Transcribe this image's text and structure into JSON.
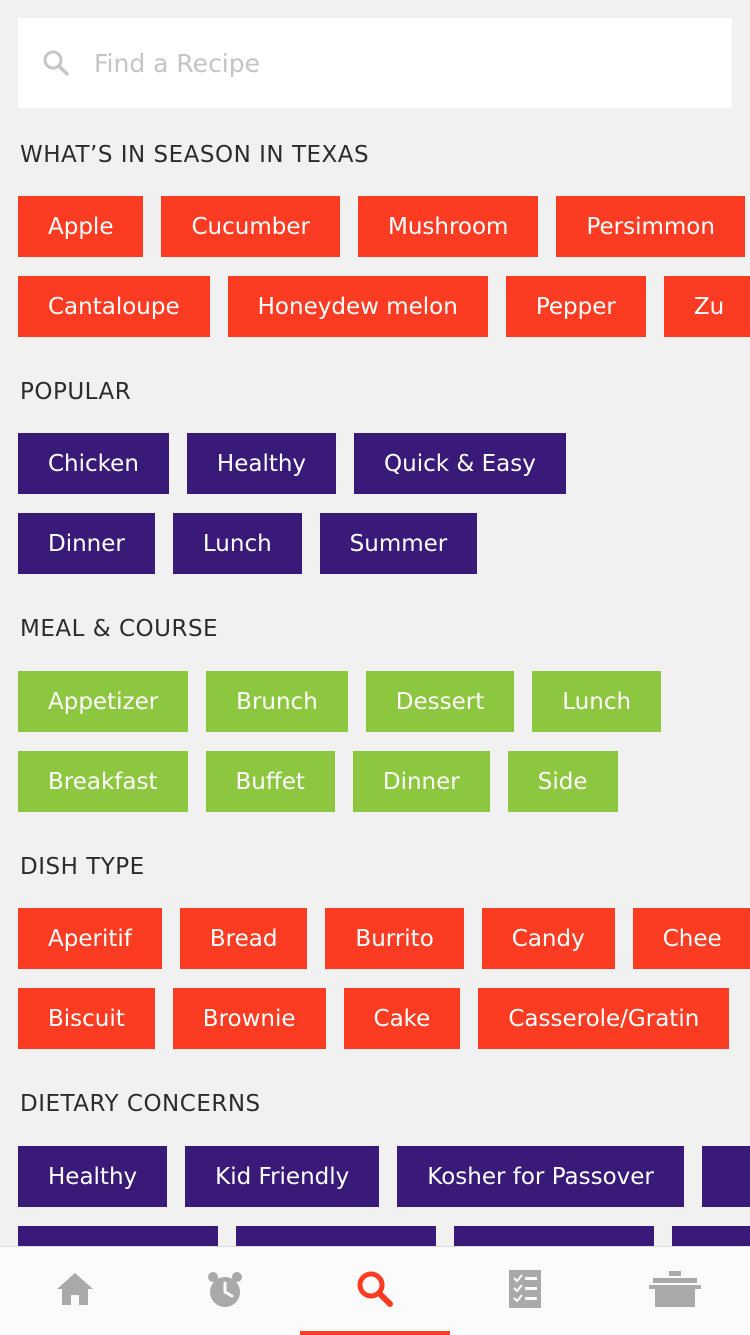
{
  "search": {
    "placeholder": "Find a Recipe",
    "value": ""
  },
  "colors": {
    "red": "#fb3c22",
    "purple": "#3a1a78",
    "green": "#8dc63f",
    "icon_gray": "#a9a9a9",
    "active": "#fb3c22"
  },
  "sections": [
    {
      "title": "WHAT’S IN SEASON IN TEXAS",
      "color": "red",
      "rows": [
        [
          "Apple",
          "Cucumber",
          "Mushroom",
          "Persimmon"
        ],
        [
          "Cantaloupe",
          "Honeydew melon",
          "Pepper",
          "Zu"
        ]
      ]
    },
    {
      "title": "POPULAR",
      "color": "purple",
      "rows": [
        [
          "Chicken",
          "Healthy",
          "Quick & Easy"
        ],
        [
          "Dinner",
          "Lunch",
          "Summer"
        ]
      ]
    },
    {
      "title": "MEAL & COURSE",
      "color": "green",
      "rows": [
        [
          "Appetizer",
          "Brunch",
          "Dessert",
          "Lunch"
        ],
        [
          "Breakfast",
          "Buffet",
          "Dinner",
          "Side"
        ]
      ]
    },
    {
      "title": "DISH TYPE",
      "color": "red",
      "rows": [
        [
          "Aperitif",
          "Bread",
          "Burrito",
          "Candy",
          "Chee"
        ],
        [
          "Biscuit",
          "Brownie",
          "Cake",
          "Casserole/Gratin"
        ]
      ]
    },
    {
      "title": "DIETARY CONCERNS",
      "color": "purple",
      "rows": [
        [
          "Healthy",
          "Kid Friendly",
          "Kosher for Passover",
          ""
        ],
        [
          "",
          "",
          "",
          ""
        ]
      ]
    }
  ],
  "tabs": [
    {
      "icon": "home-icon",
      "active": false
    },
    {
      "icon": "alarm-clock-icon",
      "active": false
    },
    {
      "icon": "search-icon",
      "active": true
    },
    {
      "icon": "checklist-icon",
      "active": false
    },
    {
      "icon": "cooking-pot-icon",
      "active": false
    }
  ]
}
